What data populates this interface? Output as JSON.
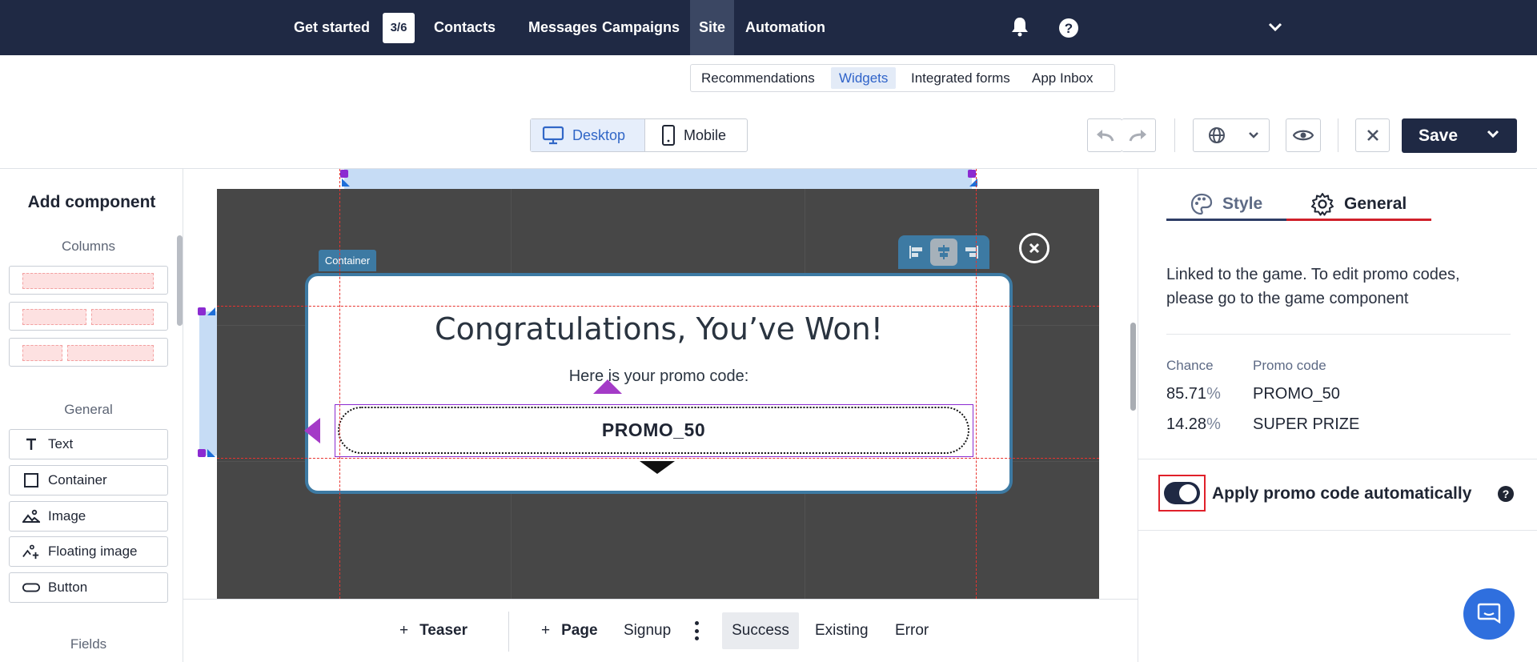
{
  "topnav": {
    "items": [
      {
        "label": "Get started",
        "badge": "3/6"
      },
      {
        "label": "Contacts"
      },
      {
        "label": "Messages"
      },
      {
        "label": "Campaigns"
      },
      {
        "label": "Site",
        "active": true
      },
      {
        "label": "Automation"
      }
    ],
    "icons": [
      "bell-icon",
      "help-icon",
      "chevron-down-icon"
    ]
  },
  "subtabs": [
    {
      "label": "Recommendations"
    },
    {
      "label": "Widgets",
      "active": true
    },
    {
      "label": "Integrated forms"
    },
    {
      "label": "App Inbox"
    }
  ],
  "toolbar": {
    "device": {
      "desktop": "Desktop",
      "mobile": "Mobile",
      "selected": "Desktop"
    },
    "save_label": "Save"
  },
  "left_sidebar": {
    "title": "Add component",
    "columns_label": "Columns",
    "general_label": "General",
    "components": [
      {
        "label": "Text",
        "icon": "text-icon"
      },
      {
        "label": "Container",
        "icon": "container-icon"
      },
      {
        "label": "Image",
        "icon": "image-icon"
      },
      {
        "label": "Floating image",
        "icon": "floating-image-icon"
      },
      {
        "label": "Button",
        "icon": "button-icon"
      }
    ],
    "fields_label": "Fields"
  },
  "canvas": {
    "container_tag": "Container",
    "popup_title": "Congratulations, You’ve Won!",
    "popup_subtitle": "Here is your promo code:",
    "promo_code": "PROMO_50"
  },
  "bottom_tabs": [
    {
      "label": "Teaser",
      "prefix": "+"
    },
    {
      "label": "Page",
      "prefix": "+"
    },
    {
      "label": "Signup"
    },
    {
      "label": "Success",
      "active": true
    },
    {
      "label": "Existing"
    },
    {
      "label": "Error"
    }
  ],
  "right_panel": {
    "tabs": [
      {
        "label": "Style"
      },
      {
        "label": "General",
        "active": true
      }
    ],
    "info_text": "Linked to the game. To edit promo codes, please go to the game component",
    "table": {
      "headers": [
        "Chance",
        "Promo code"
      ],
      "rows": [
        {
          "chance": "85.71",
          "code": "PROMO_50"
        },
        {
          "chance": "14.28",
          "code": "SUPER PRIZE"
        }
      ],
      "pct": "%"
    },
    "apply_label": "Apply promo code automatically",
    "apply_enabled": true,
    "help": "?"
  },
  "colors": {
    "nav_bg": "#1f2944",
    "accent_blue": "#3167c7",
    "container_blue": "#3d7aa3",
    "selection_purple": "#8b2bd1",
    "guide_red": "#e8332f",
    "active_tab_red": "#d0202a"
  }
}
